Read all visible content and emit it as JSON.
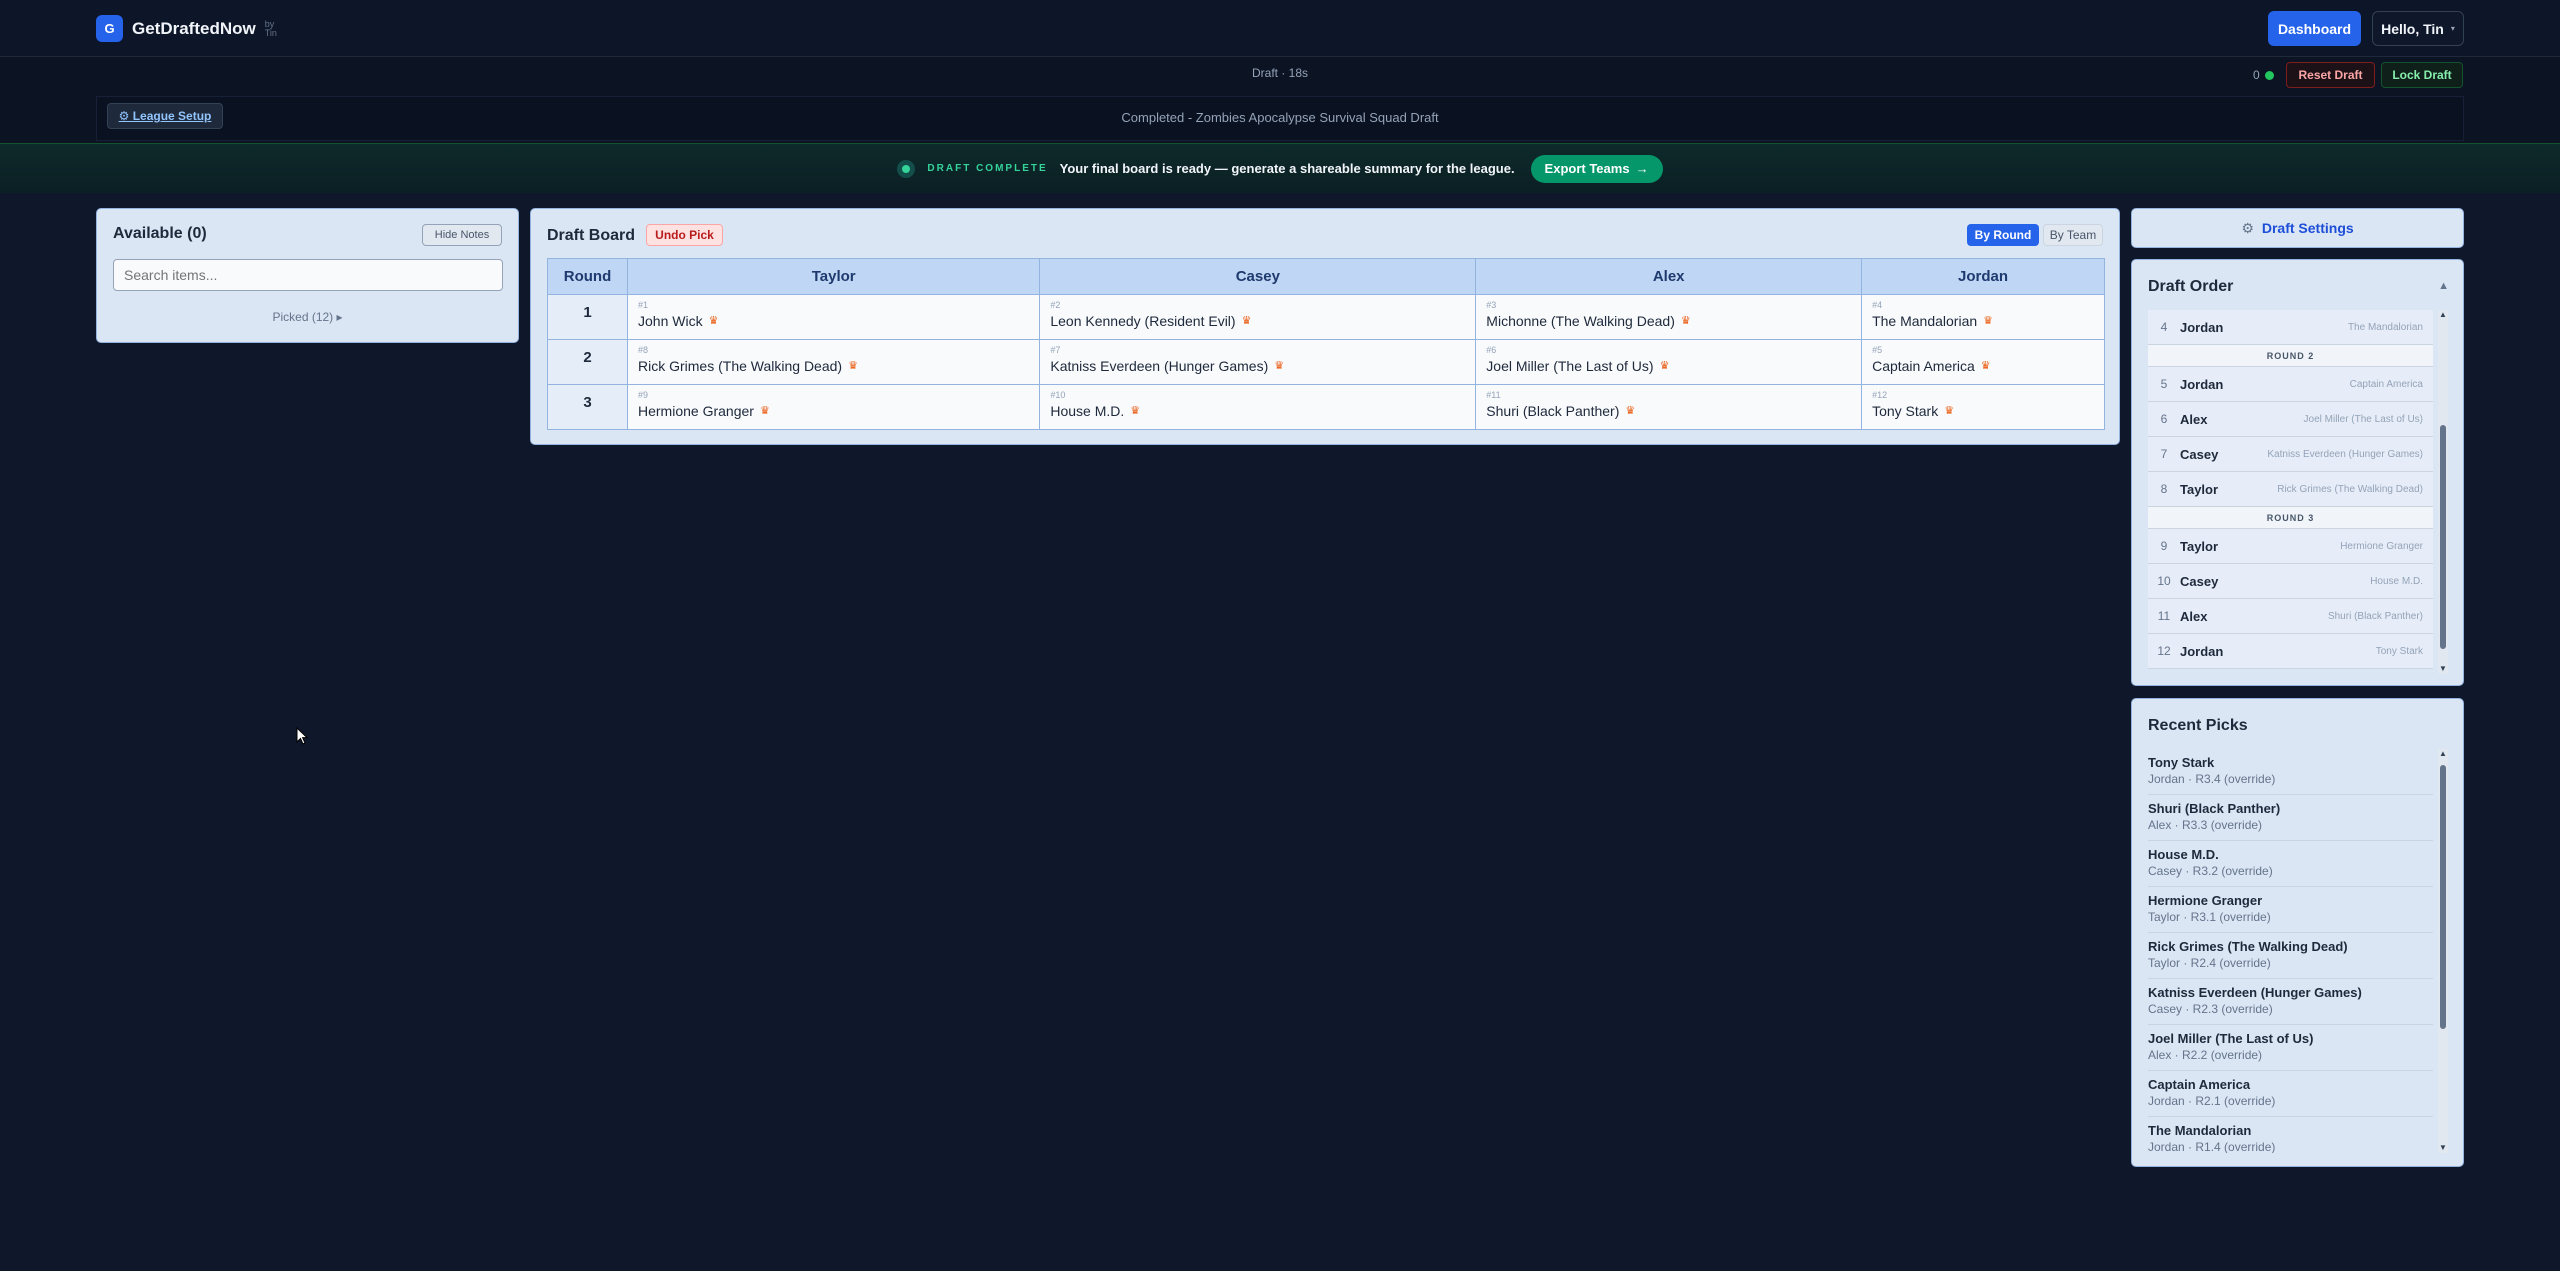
{
  "nav": {
    "logo_letter": "G",
    "brand": "GetDraftedNow",
    "brand_by": "by Tin",
    "dashboard_label": "Dashboard",
    "user_label": "Hello, Tin"
  },
  "status": {
    "timer": "Draft · 18s",
    "online_count": "0",
    "reset_label": "Reset Draft",
    "lock_label": "Lock Draft",
    "league_setup_label": "⚙ League Setup",
    "league_status": "Completed - Zombies Apocalypse Survival Squad Draft"
  },
  "banner": {
    "tag": "DRAFT COMPLETE",
    "message": "Your final board is ready — generate a shareable summary for the league.",
    "export_label": "Export Teams",
    "export_arrow": "→"
  },
  "available": {
    "title": "Available (0)",
    "hide_notes_label": "Hide Notes",
    "search_placeholder": "Search items...",
    "picked_toggle": "Picked (12) ▸"
  },
  "board": {
    "title": "Draft Board",
    "undo_label": "Undo Pick",
    "view_round_label": "By Round",
    "view_team_label": "By Team",
    "round_header": "Round",
    "teams": [
      "Taylor",
      "Casey",
      "Alex",
      "Jordan"
    ],
    "rounds": [
      {
        "round": "1",
        "picks": [
          {
            "no": "#1",
            "name": "John Wick"
          },
          {
            "no": "#2",
            "name": "Leon Kennedy (Resident Evil)"
          },
          {
            "no": "#3",
            "name": "Michonne (The Walking Dead)"
          },
          {
            "no": "#4",
            "name": "The Mandalorian"
          }
        ]
      },
      {
        "round": "2",
        "picks": [
          {
            "no": "#8",
            "name": "Rick Grimes (The Walking Dead)"
          },
          {
            "no": "#7",
            "name": "Katniss Everdeen (Hunger Games)"
          },
          {
            "no": "#6",
            "name": "Joel Miller (The Last of Us)"
          },
          {
            "no": "#5",
            "name": "Captain America"
          }
        ]
      },
      {
        "round": "3",
        "picks": [
          {
            "no": "#9",
            "name": "Hermione Granger"
          },
          {
            "no": "#10",
            "name": "House M.D."
          },
          {
            "no": "#11",
            "name": "Shuri (Black Panther)"
          },
          {
            "no": "#12",
            "name": "Tony Stark"
          }
        ]
      }
    ]
  },
  "settings": {
    "label": "Draft Settings"
  },
  "order": {
    "title": "Draft Order",
    "collapse_glyph": "▲",
    "rows": [
      {
        "kind": "pick",
        "no": "4",
        "team": "Jordan",
        "pick": "The Mandalorian"
      },
      {
        "kind": "round",
        "label": "ROUND 2"
      },
      {
        "kind": "pick",
        "no": "5",
        "team": "Jordan",
        "pick": "Captain America"
      },
      {
        "kind": "pick",
        "no": "6",
        "team": "Alex",
        "pick": "Joel Miller (The Last of Us)"
      },
      {
        "kind": "pick",
        "no": "7",
        "team": "Casey",
        "pick": "Katniss Everdeen (Hunger Games)"
      },
      {
        "kind": "pick",
        "no": "8",
        "team": "Taylor",
        "pick": "Rick Grimes (The Walking Dead)"
      },
      {
        "kind": "round",
        "label": "ROUND 3"
      },
      {
        "kind": "pick",
        "no": "9",
        "team": "Taylor",
        "pick": "Hermione Granger"
      },
      {
        "kind": "pick",
        "no": "10",
        "team": "Casey",
        "pick": "House M.D."
      },
      {
        "kind": "pick",
        "no": "11",
        "team": "Alex",
        "pick": "Shuri (Black Panther)"
      },
      {
        "kind": "pick",
        "no": "12",
        "team": "Jordan",
        "pick": "Tony Stark"
      }
    ]
  },
  "recent": {
    "title": "Recent Picks",
    "items": [
      {
        "name": "Tony Stark",
        "meta": "Jordan · R3.4 (override)"
      },
      {
        "name": "Shuri (Black Panther)",
        "meta": "Alex · R3.3 (override)"
      },
      {
        "name": "House M.D.",
        "meta": "Casey · R3.2 (override)"
      },
      {
        "name": "Hermione Granger",
        "meta": "Taylor · R3.1 (override)"
      },
      {
        "name": "Rick Grimes (The Walking Dead)",
        "meta": "Taylor · R2.4 (override)"
      },
      {
        "name": "Katniss Everdeen (Hunger Games)",
        "meta": "Casey · R2.3 (override)"
      },
      {
        "name": "Joel Miller (The Last of Us)",
        "meta": "Alex · R2.2 (override)"
      },
      {
        "name": "Captain America",
        "meta": "Jordan · R2.1 (override)"
      },
      {
        "name": "The Mandalorian",
        "meta": "Jordan · R1.4 (override)"
      }
    ]
  },
  "colors": {
    "accent": "#2563eb",
    "success": "#059669",
    "danger": "#b91c1c",
    "background": "#0f172a",
    "panel": "#dbe6f5"
  },
  "icons": {
    "crown": "crown-icon",
    "gear": "gear-icon",
    "status_dot": "online-dot-icon"
  }
}
